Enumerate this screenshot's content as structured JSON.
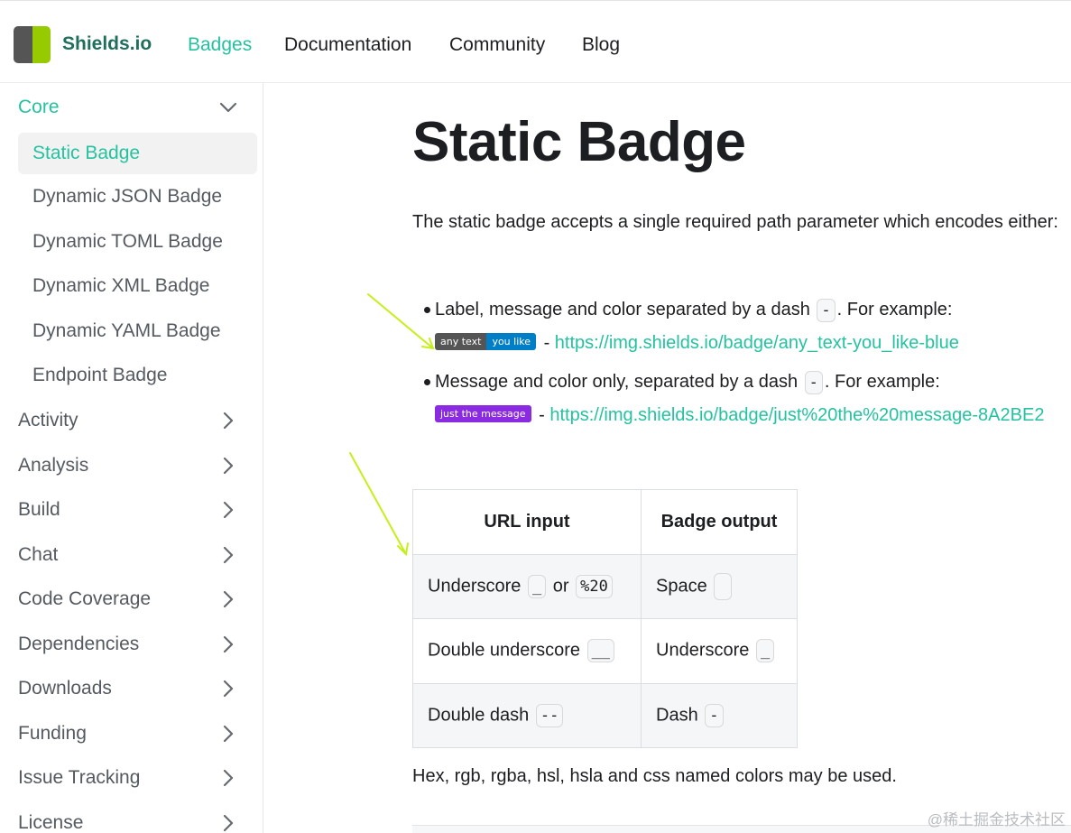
{
  "navbar": {
    "brand": "Shields.io",
    "links": [
      {
        "label": "Badges",
        "active": true
      },
      {
        "label": "Documentation",
        "active": false
      },
      {
        "label": "Community",
        "active": false
      },
      {
        "label": "Blog",
        "active": false
      }
    ]
  },
  "sidebar": {
    "core": "Core",
    "core_items": [
      "Static Badge",
      "Dynamic JSON Badge",
      "Dynamic TOML Badge",
      "Dynamic XML Badge",
      "Dynamic YAML Badge",
      "Endpoint Badge"
    ],
    "categories": [
      "Activity",
      "Analysis",
      "Build",
      "Chat",
      "Code Coverage",
      "Dependencies",
      "Downloads",
      "Funding",
      "Issue Tracking",
      "License"
    ]
  },
  "main": {
    "title": "Static Badge",
    "intro": "The static badge accepts a single required path parameter which encodes either:",
    "bullet1": {
      "text_before": "Label, message and color separated by a dash",
      "code": "-",
      "text_after": ". For example:",
      "badge_label": "any text",
      "badge_message": "you like",
      "separator": " - ",
      "link": "https://img.shields.io/badge/any_text-you_like-blue"
    },
    "bullet2": {
      "text_before": "Message and color only, separated by a dash",
      "code": "-",
      "text_after": ". For example:",
      "badge_message": "just the message",
      "separator": " - ",
      "link": "https://img.shields.io/badge/just%20the%20message-8A2BE2"
    },
    "table": {
      "headers": [
        "URL input",
        "Badge output"
      ],
      "rows": [
        {
          "input_text": "Underscore",
          "input_code": "_",
          "input_or": "or",
          "input_code2": "%20",
          "output_text": "Space",
          "output_code": " "
        },
        {
          "input_text": "Double underscore",
          "input_code": "__",
          "output_text": "Underscore",
          "output_code": "_"
        },
        {
          "input_text": "Double dash",
          "input_code": "--",
          "output_text": "Dash",
          "output_code": "-"
        }
      ]
    },
    "colors_note": "Hex, rgb, rgba, hsl, hsla and css named colors may be used."
  },
  "watermark": "@稀土掘金技术社区",
  "colors": {
    "accent": "#25c2a0",
    "badge_blue": "#007ec6",
    "badge_purple": "#8a2be2",
    "badge_gray": "#555555",
    "arrow": "#c6ef1a"
  }
}
